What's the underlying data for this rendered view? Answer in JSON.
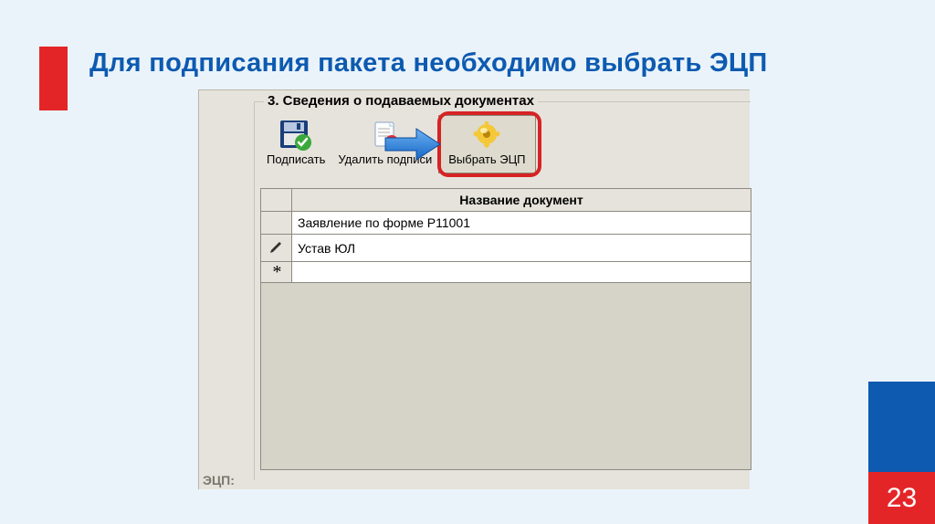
{
  "title": "Для подписания пакета необходимо выбрать ЭЦП",
  "page_number": "23",
  "group": {
    "legend": "3. Сведения о подаваемых документах"
  },
  "toolbar": {
    "sign": "Подписать",
    "delete": "Удалить подписи",
    "choose": "Выбрать ЭЦП"
  },
  "tooltip": "Выбрать ЭЦП",
  "grid": {
    "header_col1": "",
    "header_col2": "Название документ",
    "rows": [
      {
        "mark": "",
        "name": "Заявление по форме Р11001"
      },
      {
        "mark": "pencil",
        "name": "Устав ЮЛ"
      },
      {
        "mark": "star",
        "name": ""
      }
    ]
  },
  "footer": "ЭЦП:"
}
